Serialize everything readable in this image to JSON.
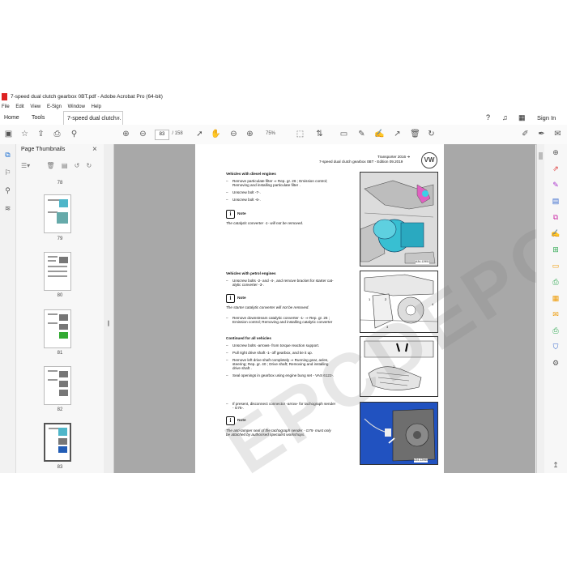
{
  "window": {
    "title": "7-speed dual clutch gearbox 0BT.pdf - Adobe Acrobat Pro (64-bit)"
  },
  "menu": [
    "File",
    "Edit",
    "View",
    "E-Sign",
    "Window",
    "Help"
  ],
  "tabs": {
    "home": "Home",
    "tools": "Tools",
    "document": "7-speed dual clutch..."
  },
  "sign_in": "Sign In",
  "toolbar": {
    "page_current": "83",
    "page_total": "/ 158",
    "zoom": "75%"
  },
  "thumbnails": {
    "header": "Page Thumbnails",
    "pages": [
      "78",
      "79",
      "80",
      "81",
      "82",
      "83"
    ]
  },
  "watermark": "EPCDEPOT.COM",
  "page": {
    "header_line1": "Transporter 2016 ➜",
    "header_line2": "7-speed dual clutch gearbox 0BT - Edition 09.2019",
    "logo": "VW",
    "sec1_title": "Vehicles with diesel engines",
    "sec1_items": [
      "Remove particulate filter ⇒ Rep. gr. 26 ; Emission control;",
      "Removing and installing particulate filter .",
      "Unscrew bolt -7-.",
      "Unscrew bolt -6-."
    ],
    "note_label": "Note",
    "note1": "The catalytic converter -1- will not be removed.",
    "sec2_title": "Vehicles with petrol engines",
    "sec2_items": [
      "Unscrew bolts -2- and -4-, and remove bracket for starter cat-",
      "alytic converter -3-."
    ],
    "note2": "The starter catalytic converter will not be removed.",
    "sec2_items_b": [
      "Remove downstream catalytic converter -1- ⇒ Rep. gr. 26 ;",
      "Emission control; Removing and installing catalytic converter"
    ],
    "sec3_title": "Continued for all vehicles",
    "sec3_items": [
      "Unscrew bolts -arrows- from torque reaction support.",
      "Pull right drive shaft -1- off gearbox, and tie it up.",
      "Remove left drive shaft completely ⇒ Running gear, axles,",
      "steering; Rep. gr. 40 ; Drive shaft; Removing and installing",
      "drive shaft .",
      "Seal openings in gearbox using engine bung set - VAS 6122-."
    ],
    "sec4_items": [
      "If present, disconnect connector -arrow- for tachograph sender",
      "- G75-."
    ],
    "note3_a": "The anti-tamper seal of the tachograph sender - G75- must only",
    "note3_b": "be attached by authorised specialist workshops.",
    "fig_ids": [
      "A34-12951",
      "A34-12953",
      "A34-12958",
      "A34-12960"
    ]
  }
}
